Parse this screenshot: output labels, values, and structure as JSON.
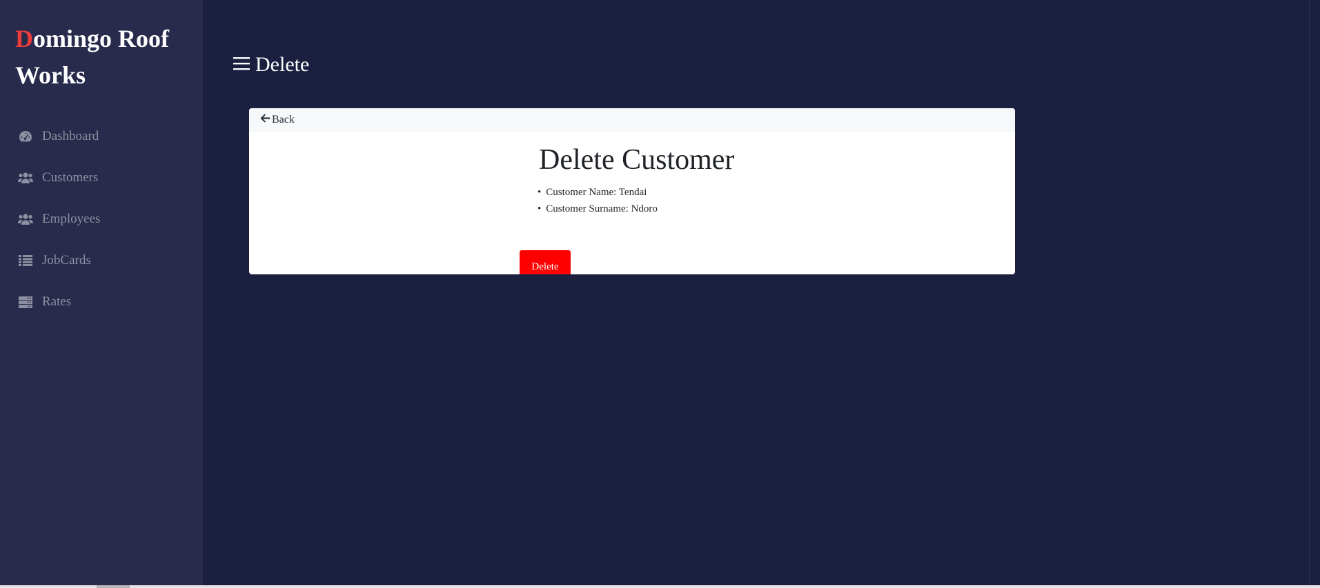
{
  "brand": {
    "first_letter": "D",
    "rest": "omingo Roof Works"
  },
  "sidebar": {
    "items": [
      {
        "label": "Dashboard",
        "icon": "tachometer-icon"
      },
      {
        "label": "Customers",
        "icon": "users-icon"
      },
      {
        "label": "Employees",
        "icon": "users-icon"
      },
      {
        "label": "JobCards",
        "icon": "list-icon"
      },
      {
        "label": "Rates",
        "icon": "server-icon"
      }
    ]
  },
  "topbar": {
    "menu_icon": "hamburger-menu-icon",
    "title": "Delete"
  },
  "card": {
    "back_label": "Back",
    "back_icon": "arrow-left-icon",
    "title": "Delete Customer",
    "details": [
      "Customer Name: Tendai",
      "Customer Surname: Ndoro"
    ],
    "delete_label": "Delete"
  },
  "colors": {
    "page_background": "#1c2040",
    "sidebar_background": "#282b4c",
    "brand_accent": "#ec3c3c",
    "delete_button": "#ff0000",
    "nav_text": "#8e90a1"
  }
}
